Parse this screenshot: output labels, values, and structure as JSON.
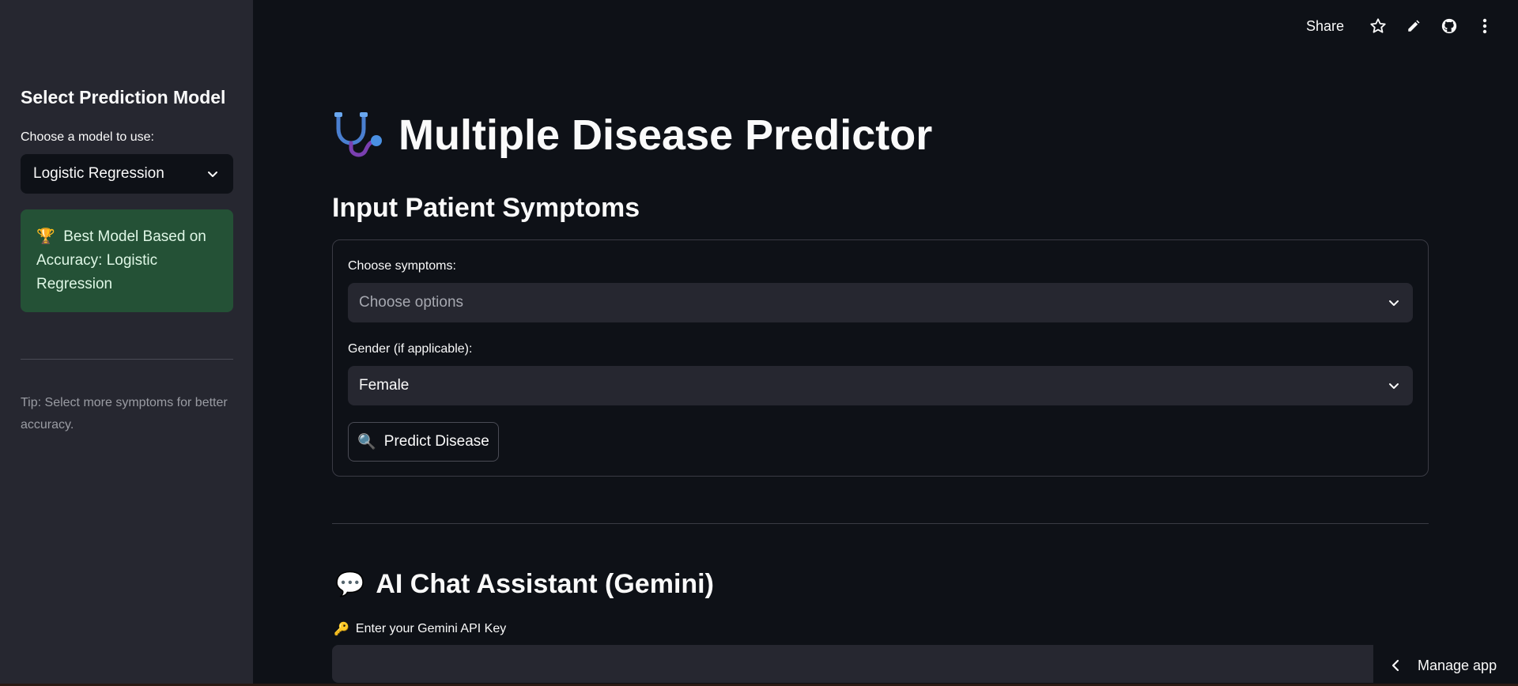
{
  "sidebar": {
    "title": "Select Prediction Model",
    "model_label": "Choose a model to use:",
    "model_value": "Logistic Regression",
    "best_model_icon": "trophy-icon",
    "best_model_text": "Best Model Based on Accuracy: Logistic Regression",
    "tip": "Tip: Select more symptoms for better accuracy."
  },
  "toolbar": {
    "share_label": "Share",
    "icons": [
      "star-icon",
      "pencil-icon",
      "github-icon",
      "more-vertical-icon"
    ]
  },
  "main": {
    "title_icon": "stethoscope-icon",
    "title": "Multiple Disease Predictor",
    "section_title": "Input Patient Symptoms",
    "symptoms_label": "Choose symptoms:",
    "symptoms_placeholder": "Choose options",
    "gender_label": "Gender (if applicable):",
    "gender_value": "Female",
    "predict_icon": "magnifier-icon",
    "predict_label": "Predict Disease"
  },
  "chat": {
    "title_icon": "speech-bubble-icon",
    "title": "AI Chat Assistant (Gemini)",
    "api_key_icon": "key-icon",
    "api_key_label": "Enter your Gemini API Key",
    "api_key_value": ""
  },
  "manage_app": {
    "label": "Manage app"
  },
  "colors": {
    "background": "#0e1117",
    "sidebar": "#262730",
    "success_bg": "#245136",
    "input_bg": "#262730"
  }
}
